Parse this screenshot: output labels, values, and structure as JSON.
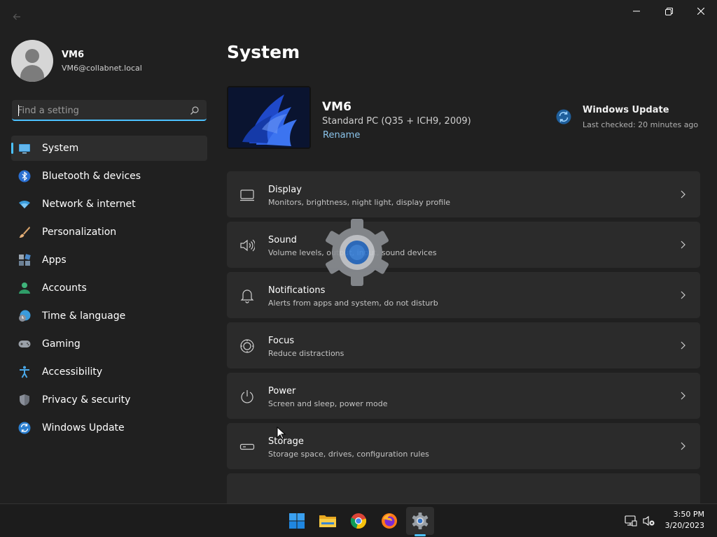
{
  "profile": {
    "name": "VM6",
    "email": "VM6@collabnet.local"
  },
  "search": {
    "placeholder": "Find a setting"
  },
  "sidebar": {
    "items": [
      {
        "label": "System",
        "icon": "system-icon",
        "active": true
      },
      {
        "label": "Bluetooth & devices",
        "icon": "bluetooth-icon"
      },
      {
        "label": "Network & internet",
        "icon": "wifi-icon"
      },
      {
        "label": "Personalization",
        "icon": "brush-icon"
      },
      {
        "label": "Apps",
        "icon": "apps-icon"
      },
      {
        "label": "Accounts",
        "icon": "person-icon"
      },
      {
        "label": "Time & language",
        "icon": "clock-globe-icon"
      },
      {
        "label": "Gaming",
        "icon": "gamepad-icon"
      },
      {
        "label": "Accessibility",
        "icon": "accessibility-icon"
      },
      {
        "label": "Privacy & security",
        "icon": "shield-icon"
      },
      {
        "label": "Windows Update",
        "icon": "update-icon"
      }
    ]
  },
  "main": {
    "title": "System",
    "device": {
      "name": "VM6",
      "model": "Standard PC (Q35 + ICH9, 2009)",
      "rename_label": "Rename"
    },
    "windows_update": {
      "title": "Windows Update",
      "status": "Last checked: 20 minutes ago"
    },
    "cards": [
      {
        "title": "Display",
        "subtitle": "Monitors, brightness, night light, display profile",
        "icon": "monitor-icon"
      },
      {
        "title": "Sound",
        "subtitle": "Volume levels, output, input, sound devices",
        "icon": "speaker-icon"
      },
      {
        "title": "Notifications",
        "subtitle": "Alerts from apps and system, do not disturb",
        "icon": "bell-icon"
      },
      {
        "title": "Focus",
        "subtitle": "Reduce distractions",
        "icon": "focus-icon"
      },
      {
        "title": "Power",
        "subtitle": "Screen and sleep, power mode",
        "icon": "power-icon"
      },
      {
        "title": "Storage",
        "subtitle": "Storage space, drives, configuration rules",
        "icon": "storage-icon"
      }
    ]
  },
  "taskbar": {
    "apps": [
      "start-icon",
      "file-explorer-icon",
      "chrome-icon",
      "firefox-icon",
      "settings-icon"
    ],
    "active_app": "settings-icon",
    "time": "3:50 PM",
    "date": "3/20/2023"
  },
  "colors": {
    "accent": "#4cc2ff",
    "background": "#202020",
    "card": "#2b2b2b"
  }
}
